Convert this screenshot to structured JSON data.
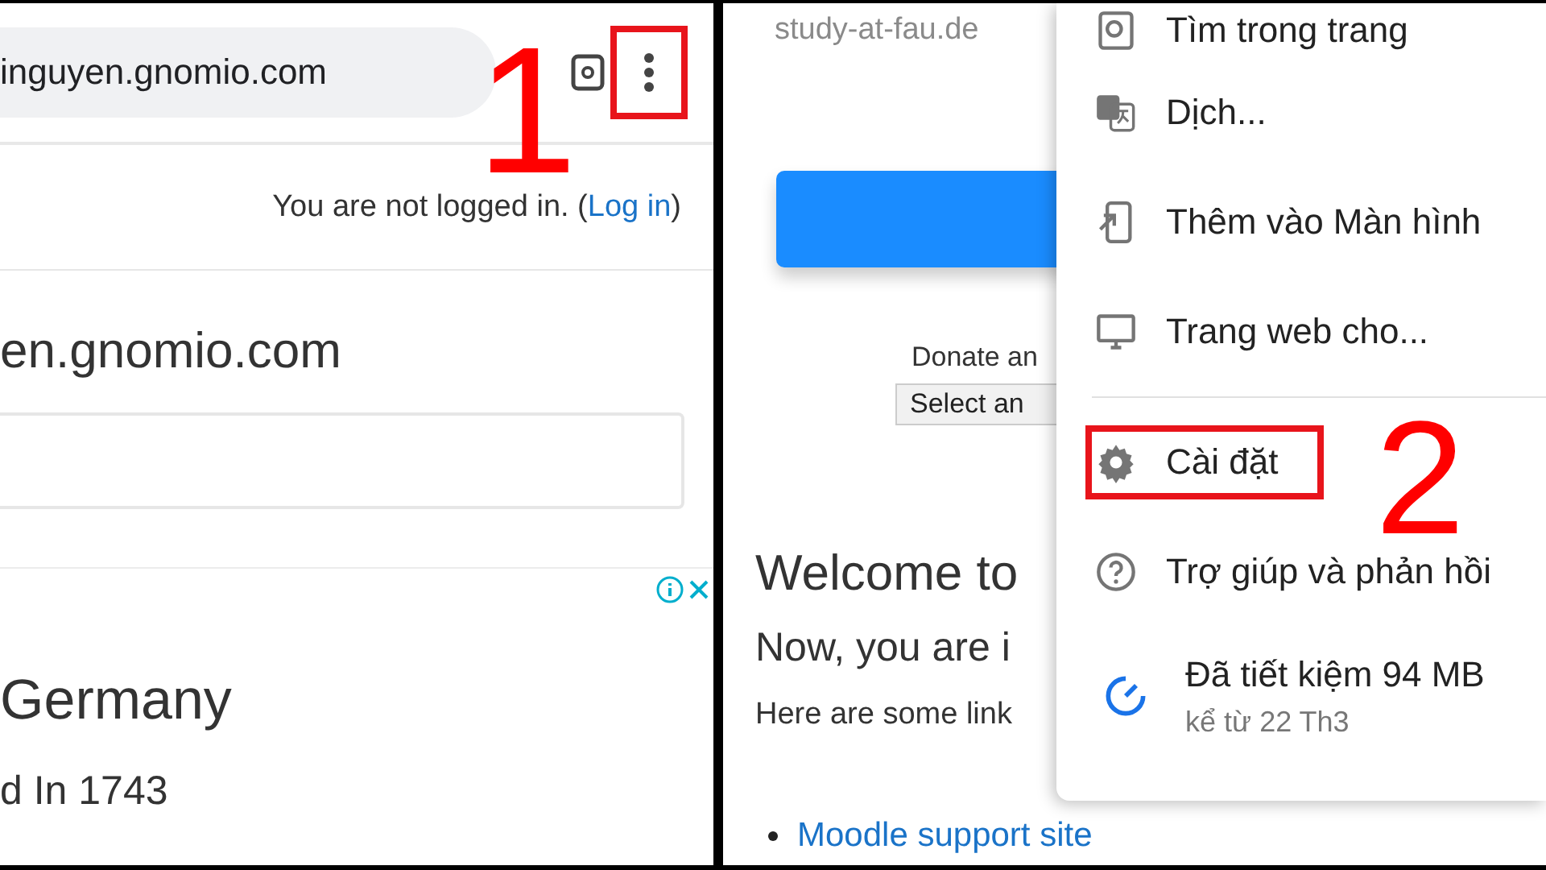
{
  "left_screen": {
    "url": "inguyen.gnomio.com",
    "menu_button": {
      "highlighted": true
    },
    "annotation": "1",
    "login_status": "You are not logged in. (",
    "login_link": "Log in",
    "login_close": ")",
    "site_title": "en.gnomio.com",
    "ad_heading": "Germany",
    "ad_subheading": "d In 1743"
  },
  "right_screen": {
    "url": "study-at-fau.de",
    "donate_label": "Donate an",
    "select_value": "Select an",
    "welcome": "Welcome to",
    "subtitle": "Now, you are i",
    "intro": "Here are some link",
    "links": [
      "Moodle support site"
    ],
    "annotation": "2",
    "menu": [
      {
        "kind": "item",
        "label": "Tìm trong trang",
        "highlighted": false
      },
      {
        "kind": "item",
        "label": "Dịch...",
        "highlighted": false
      },
      {
        "kind": "item",
        "label": "Thêm vào Màn hình",
        "highlighted": false
      },
      {
        "kind": "item",
        "label": "Trang web cho...",
        "highlighted": false
      },
      {
        "kind": "separator"
      },
      {
        "kind": "item",
        "label": "Cài đặt",
        "highlighted": true
      },
      {
        "kind": "item",
        "label": "Trợ giúp và phản hồi",
        "highlighted": false
      },
      {
        "kind": "saved",
        "label": "Đã tiết kiệm 94 MB",
        "detail": "kể từ 22 Th3",
        "highlighted": false
      }
    ]
  }
}
